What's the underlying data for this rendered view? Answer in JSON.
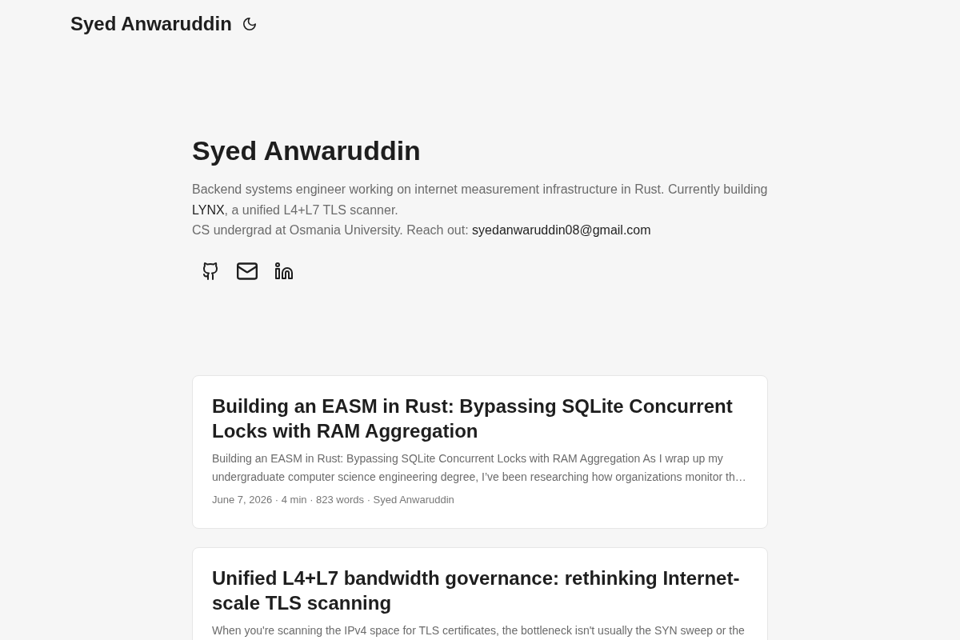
{
  "header": {
    "site_title": "Syed Anwaruddin"
  },
  "intro": {
    "title": "Syed Anwaruddin",
    "paragraphs": [
      [
        {
          "kind": "text",
          "text": "Backend systems engineer working on internet measurement infrastructure in Rust. Currently building "
        },
        {
          "kind": "link",
          "text": "LYNX"
        },
        {
          "kind": "text",
          "text": ", a unified L4+L7 TLS scanner."
        }
      ],
      [
        {
          "kind": "text",
          "text": "CS undergrad at Osmania University. Reach out: "
        },
        {
          "kind": "link",
          "text": "syedanwaruddin08@gmail.com"
        }
      ]
    ],
    "social_links": [
      {
        "kind": "github"
      },
      {
        "kind": "mail"
      },
      {
        "kind": "linkedin"
      }
    ]
  },
  "posts": [
    {
      "title": "Building an EASM in Rust: Bypassing SQLite Concurrent Locks with RAM Aggregation",
      "summary": "Building an EASM in Rust: Bypassing SQLite Concurrent Locks with RAM Aggregation As I wrap up my undergraduate computer science engineering degree, I’ve been researching how organizations monitor th…",
      "meta": "June 7, 2026 · 4 min · 823 words · Syed Anwaruddin"
    },
    {
      "title": "Unified L4+L7 bandwidth governance: rethinking Internet-scale TLS scanning",
      "summary": "When you're scanning the IPv4 space for TLS certificates, the bottleneck isn't usually the SYN sweep or the"
    }
  ]
}
